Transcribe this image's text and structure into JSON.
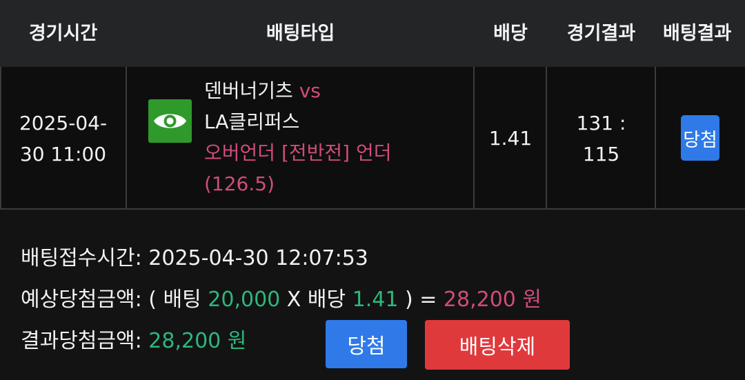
{
  "table": {
    "headers": [
      "경기시간",
      "배팅타입",
      "배당",
      "경기결과",
      "배팅결과"
    ],
    "row": {
      "time_line1": "2025-04-",
      "time_line2": "30 11:00",
      "home": "덴버너기츠",
      "vs": "vs",
      "away": "LA클리퍼스",
      "bet_type": "오버언더 [전반전] 언더",
      "bet_line": "(126.5)",
      "odds": "1.41",
      "score_line1": "131 :",
      "score_line2": "115",
      "bet_result": "당첨",
      "icon": "eye-icon"
    }
  },
  "details": {
    "received_label": "배팅접수시간:",
    "received_value": "2025-04-30 12:07:53",
    "expected_label": "예상당첨금액:",
    "expected_open": "( 배팅",
    "stake": "20,000",
    "x_odds": "X 배당",
    "odds": "1.41",
    "expected_close": ") =",
    "expected_amount": "28,200 원",
    "result_label": "결과당첨금액:",
    "result_amount": "28,200 원"
  },
  "buttons": {
    "win_label": "당첨",
    "delete_label": "배팅삭제"
  },
  "colors": {
    "header_bg": "#242526",
    "green": "#2db87c",
    "pink": "#d14c7a",
    "blue": "#2f7ae8",
    "red": "#e0393c"
  }
}
